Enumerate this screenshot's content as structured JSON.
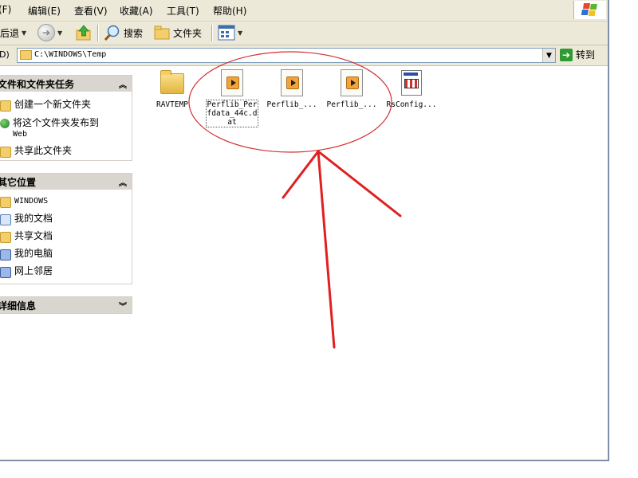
{
  "menubar": {
    "items": [
      "(F)",
      "编辑(E)",
      "查看(V)",
      "收藏(A)",
      "工具(T)",
      "帮助(H)"
    ]
  },
  "toolbar": {
    "back_label": "后退",
    "search_label": "搜索",
    "folders_label": "文件夹"
  },
  "address": {
    "label": "D)",
    "path": "C:\\WINDOWS\\Temp",
    "go_label": "转到"
  },
  "sidebar": {
    "tasks": {
      "title": "文件和文件夹任务",
      "items": [
        "创建一个新文件夹",
        "将这个文件夹发布到",
        "Web",
        "共享此文件夹"
      ]
    },
    "places": {
      "title": "其它位置",
      "items": [
        "WINDOWS",
        "我的文档",
        "共享文档",
        "我的电脑",
        "网上邻居"
      ]
    },
    "details": {
      "title": "详细信息"
    }
  },
  "files": {
    "items": [
      {
        "name": "RAVTEMP",
        "icon": "folder-icon"
      },
      {
        "name_line1": "Perflib_Per",
        "name_line2": "fdata_44c.d",
        "name_line3": "at",
        "icon": "media-file-icon"
      },
      {
        "name": "Perflib_...",
        "icon": "media-file-icon"
      },
      {
        "name": "Perflib_...",
        "icon": "media-file-icon"
      },
      {
        "name": "RsConfig...",
        "icon": "config-file-icon"
      }
    ]
  },
  "annotation": {
    "ellipse_color": "#d33030",
    "arrow_color": "#e02020"
  }
}
